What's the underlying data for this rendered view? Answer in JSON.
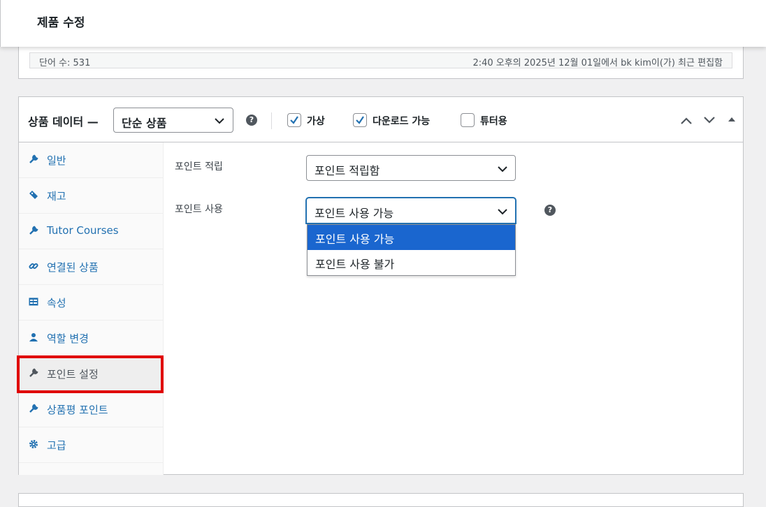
{
  "header": {
    "title": "제품 수정"
  },
  "editor": {
    "word_count": "단어 수: 531",
    "last_edit": "2:40 오후의 2025년 12월 01일에서 bk kim이(가) 최근 편집함"
  },
  "product_data": {
    "label": "상품 데이터 —",
    "type_select": {
      "value": "단순 상품"
    },
    "help": "?",
    "checkboxes": [
      {
        "label": "가상",
        "checked": true
      },
      {
        "label": "다운로드 가능",
        "checked": true
      },
      {
        "label": "튜터용",
        "checked": false
      }
    ],
    "tabs": [
      {
        "label": "일반",
        "icon": "wrench-icon"
      },
      {
        "label": "재고",
        "icon": "tag-icon"
      },
      {
        "label": "Tutor Courses",
        "icon": "wrench-icon"
      },
      {
        "label": "연결된 상품",
        "icon": "link-icon"
      },
      {
        "label": "속성",
        "icon": "table-icon"
      },
      {
        "label": "역할 변경",
        "icon": "user-icon"
      },
      {
        "label": "포인트 설정",
        "icon": "wrench-icon",
        "active": true
      },
      {
        "label": "상품평 포인트",
        "icon": "wrench-icon"
      },
      {
        "label": "고급",
        "icon": "gear-icon"
      }
    ],
    "fields": {
      "point_earn": {
        "label": "포인트 적립",
        "value": "포인트 적립함"
      },
      "point_use": {
        "label": "포인트 사용",
        "value": "포인트 사용 가능",
        "options": [
          "포인트 사용 가능",
          "포인트 사용 불가"
        ],
        "highlighted": 0
      }
    }
  },
  "colors": {
    "link": "#2271b1",
    "highlight_option": "#1a66cf",
    "annotation": "#e00000"
  }
}
